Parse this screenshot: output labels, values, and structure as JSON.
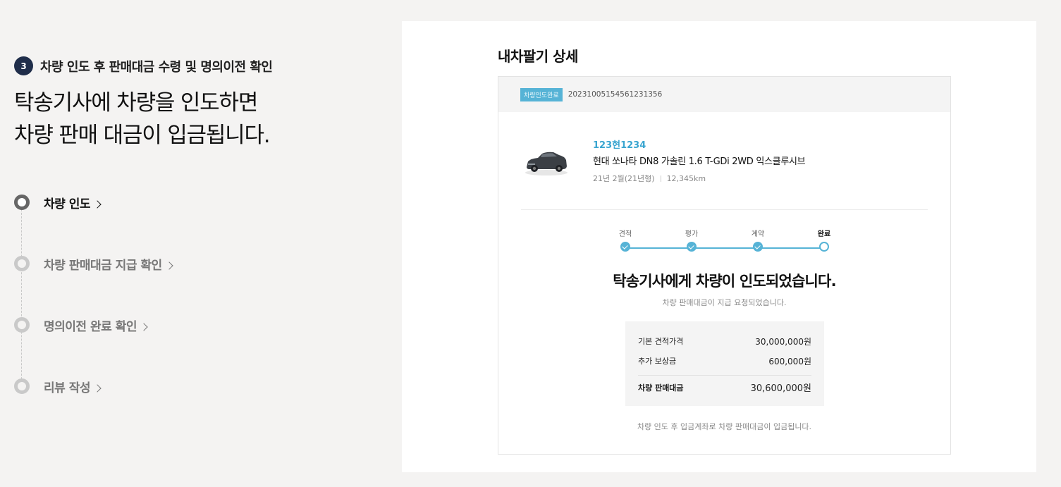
{
  "step": {
    "number": "3",
    "title": "차량 인도 후 판매대금 수령 및 명의이전 확인",
    "headline_line1": "탁송기사에 차량을 인도하면",
    "headline_line2": "차량 판매 대금이 입금됩니다."
  },
  "timeline": [
    {
      "label": "차량 인도",
      "active": true
    },
    {
      "label": "차량 판매대금 지급 확인",
      "active": false
    },
    {
      "label": "명의이전 완료 확인",
      "active": false
    },
    {
      "label": "리뷰 작성",
      "active": false
    }
  ],
  "detail": {
    "title": "내차팔기 상세",
    "badge": "차량인도완료",
    "order_no": "20231005154561231356",
    "car": {
      "plate": "123현1234",
      "model": "현대 쏘나타 DN8 가솔린 1.6 T-GDi 2WD 익스클루시브",
      "year": "21년 2월(21년형)",
      "mileage": "12,345km"
    },
    "progress": [
      {
        "label": "견적",
        "state": "done"
      },
      {
        "label": "평가",
        "state": "done"
      },
      {
        "label": "계약",
        "state": "done"
      },
      {
        "label": "완료",
        "state": "current"
      }
    ],
    "message_title": "탁송기사에게 차량이 인도되었습니다.",
    "message_sub": "차량 판매대금이 지급 요청되었습니다.",
    "prices": {
      "base_label": "기본 견적가격",
      "base_value": "30,000,000원",
      "extra_label": "추가 보상금",
      "extra_value": "600,000원",
      "total_label": "차량 판매대금",
      "total_value": "30,600,000원"
    },
    "foot_note": "차량 인도 후 입금계좌로 차량 판매대금이 입금됩니다."
  }
}
